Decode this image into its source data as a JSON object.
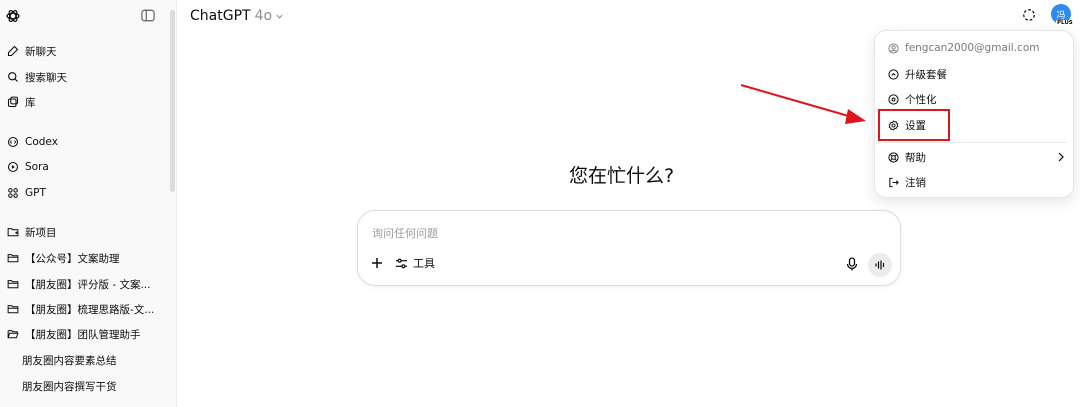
{
  "sidebar": {
    "logo_icon": "openai-logo-icon",
    "toggle_icon": "sidebar-toggle-icon",
    "top_items": [
      {
        "label": "新聊天",
        "icon": "edit-icon"
      },
      {
        "label": "搜索聊天",
        "icon": "search-icon"
      },
      {
        "label": "库",
        "icon": "library-icon"
      }
    ],
    "app_items": [
      {
        "label": "Codex",
        "icon": "codex-icon"
      },
      {
        "label": "Sora",
        "icon": "play-icon"
      },
      {
        "label": "GPT",
        "icon": "grid-icon"
      }
    ],
    "projects": [
      {
        "label": "新项目",
        "icon": "new-folder-icon"
      },
      {
        "label": "【公众号】文案助理",
        "icon": "folder-icon"
      },
      {
        "label": "【朋友圈】评分版 - 文案...",
        "icon": "folder-icon"
      },
      {
        "label": "【朋友圈】梳理思路版-文...",
        "icon": "folder-icon"
      },
      {
        "label": "【朋友圈】团队管理助手",
        "icon": "folder-open-icon"
      }
    ],
    "sub_items": [
      {
        "label": "朋友圈内容要素总结"
      },
      {
        "label": "朋友圈内容撰写干货"
      }
    ]
  },
  "header": {
    "model_name": "ChatGPT",
    "model_version": "4o",
    "avatar_text": "冯",
    "plan_badge": "PLUS"
  },
  "main": {
    "headline": "您在忙什么?",
    "composer": {
      "placeholder": "询问任何问题",
      "tools_label": "工具"
    }
  },
  "menu": {
    "email": "fengcan2000@gmail.com",
    "items": [
      {
        "label": "升级套餐",
        "icon": "upgrade-icon"
      },
      {
        "label": "个性化",
        "icon": "personalize-icon"
      },
      {
        "label": "设置",
        "icon": "gear-icon"
      },
      {
        "label": "帮助",
        "icon": "help-icon"
      },
      {
        "label": "注销",
        "icon": "logout-icon"
      }
    ]
  },
  "colors": {
    "annotation_red": "#e0141b",
    "avatar_blue": "#2e8cf0"
  }
}
